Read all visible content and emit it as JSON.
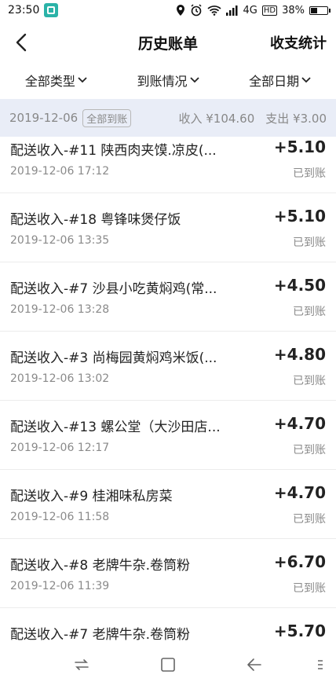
{
  "status_bar": {
    "time": "23:50",
    "network": "4G",
    "hd": "HD",
    "battery": "38%"
  },
  "header": {
    "title": "历史账单",
    "stats_label": "收支统计"
  },
  "filters": [
    {
      "label": "全部类型"
    },
    {
      "label": "到账情况"
    },
    {
      "label": "全部日期"
    }
  ],
  "summary": {
    "date": "2019-12-06",
    "badge": "全部到账",
    "income": "收入 ¥104.60",
    "expense": "支出 ¥3.00"
  },
  "transactions": [
    {
      "name": "配送收入-#11 陕西肉夹馍.凉皮(...",
      "time": "2019-12-06 17:12",
      "amount": "+5.10",
      "status": "已到账"
    },
    {
      "name": "配送收入-#18 粤锋味煲仔饭",
      "time": "2019-12-06 13:35",
      "amount": "+5.10",
      "status": "已到账"
    },
    {
      "name": "配送收入-#7 沙县小吃黄焖鸡(常...",
      "time": "2019-12-06 13:28",
      "amount": "+4.50",
      "status": "已到账"
    },
    {
      "name": "配送收入-#3 尚梅园黄焖鸡米饭(...",
      "time": "2019-12-06 13:02",
      "amount": "+4.80",
      "status": "已到账"
    },
    {
      "name": "配送收入-#13 螺公堂（大沙田店...",
      "time": "2019-12-06 12:17",
      "amount": "+4.70",
      "status": "已到账"
    },
    {
      "name": "配送收入-#9 桂湘味私房菜",
      "time": "2019-12-06 11:58",
      "amount": "+4.70",
      "status": "已到账"
    },
    {
      "name": "配送收入-#8 老牌牛杂.卷筒粉",
      "time": "2019-12-06 11:39",
      "amount": "+6.70",
      "status": "已到账"
    },
    {
      "name": "配送收入-#7 老牌牛杂.卷筒粉",
      "time": "",
      "amount": "+5.70",
      "status": ""
    }
  ],
  "colors": {
    "summary_bg": "#e9edf7",
    "muted_text": "#8a8a8a",
    "status_accent": "#2bb3a8"
  }
}
